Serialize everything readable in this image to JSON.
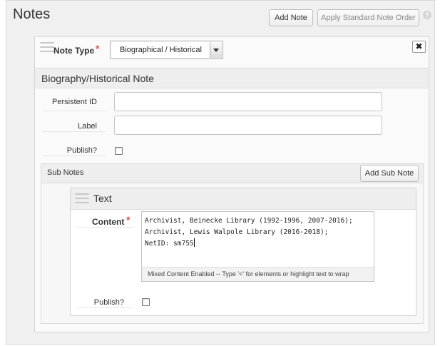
{
  "header": {
    "title": "Notes",
    "add_note_label": "Add Note",
    "apply_order_label": "Apply Standard Note Order",
    "help_icon": "question-circle-icon"
  },
  "note": {
    "type_label": "Note Type",
    "required_marker": "*",
    "type_value": "Biographical / Historical",
    "close_label": "✖",
    "section_title": "Biography/Historical Note",
    "persistent_id_label": "Persistent ID",
    "persistent_id_value": "",
    "label_label": "Label",
    "label_value": "",
    "publish_label": "Publish?",
    "publish_checked": false
  },
  "sub_notes": {
    "title": "Sub Notes",
    "add_label": "Add Sub Note",
    "text": {
      "title": "Text",
      "content_label": "Content",
      "required_marker": "*",
      "content_lines": [
        "Archivist, Beinecke Library (1992-1996, 2007-2016);",
        "Archivist, Lewis Walpole Library (2016-2018);",
        "NetID: sm755"
      ],
      "editor_hint": "Mixed Content Enabled  --  Type '<' for elements or highlight text to wrap",
      "publish_label": "Publish?",
      "publish_checked": false
    }
  },
  "colors": {
    "required": "#d9534f",
    "panel_bg": "#f0f0f0",
    "header_bg": "#eeeeee"
  }
}
